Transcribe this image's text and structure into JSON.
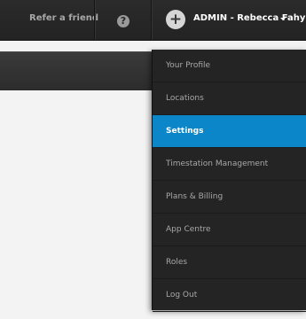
{
  "topbar": {
    "refer_label": "Refer a friend",
    "help_icon": "question-circle-icon",
    "user_avatar_icon": "plus-circle-icon",
    "user_label": "ADMIN - Rebecca Fahy"
  },
  "dropdown": {
    "items": [
      {
        "label": "Your Profile"
      },
      {
        "label": "Locations"
      },
      {
        "label": "Settings",
        "active": true
      },
      {
        "label": "Timestation Management"
      },
      {
        "label": "Plans & Billing"
      },
      {
        "label": "App Centre"
      },
      {
        "label": "Roles"
      },
      {
        "label": "Log Out"
      }
    ]
  },
  "colors": {
    "topbar": "#262626",
    "dropdown": "#242424",
    "active_item": "#0b86c8",
    "content": "#f3f3f3"
  }
}
